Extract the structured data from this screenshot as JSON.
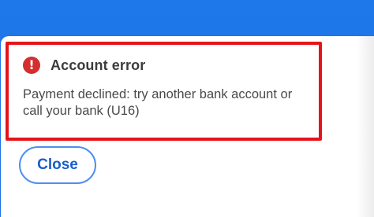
{
  "dialog": {
    "title": "Account error",
    "icon": "error-icon",
    "icon_glyph": "!",
    "message": "Payment declined: try another bank account or call your bank (U16)",
    "close_label": "Close"
  },
  "colors": {
    "backdrop": "#1a73e8",
    "error": "#d32f2f",
    "highlight": "#e4141b",
    "button_text": "#1a5fc8",
    "button_border": "#4f8ff0"
  }
}
